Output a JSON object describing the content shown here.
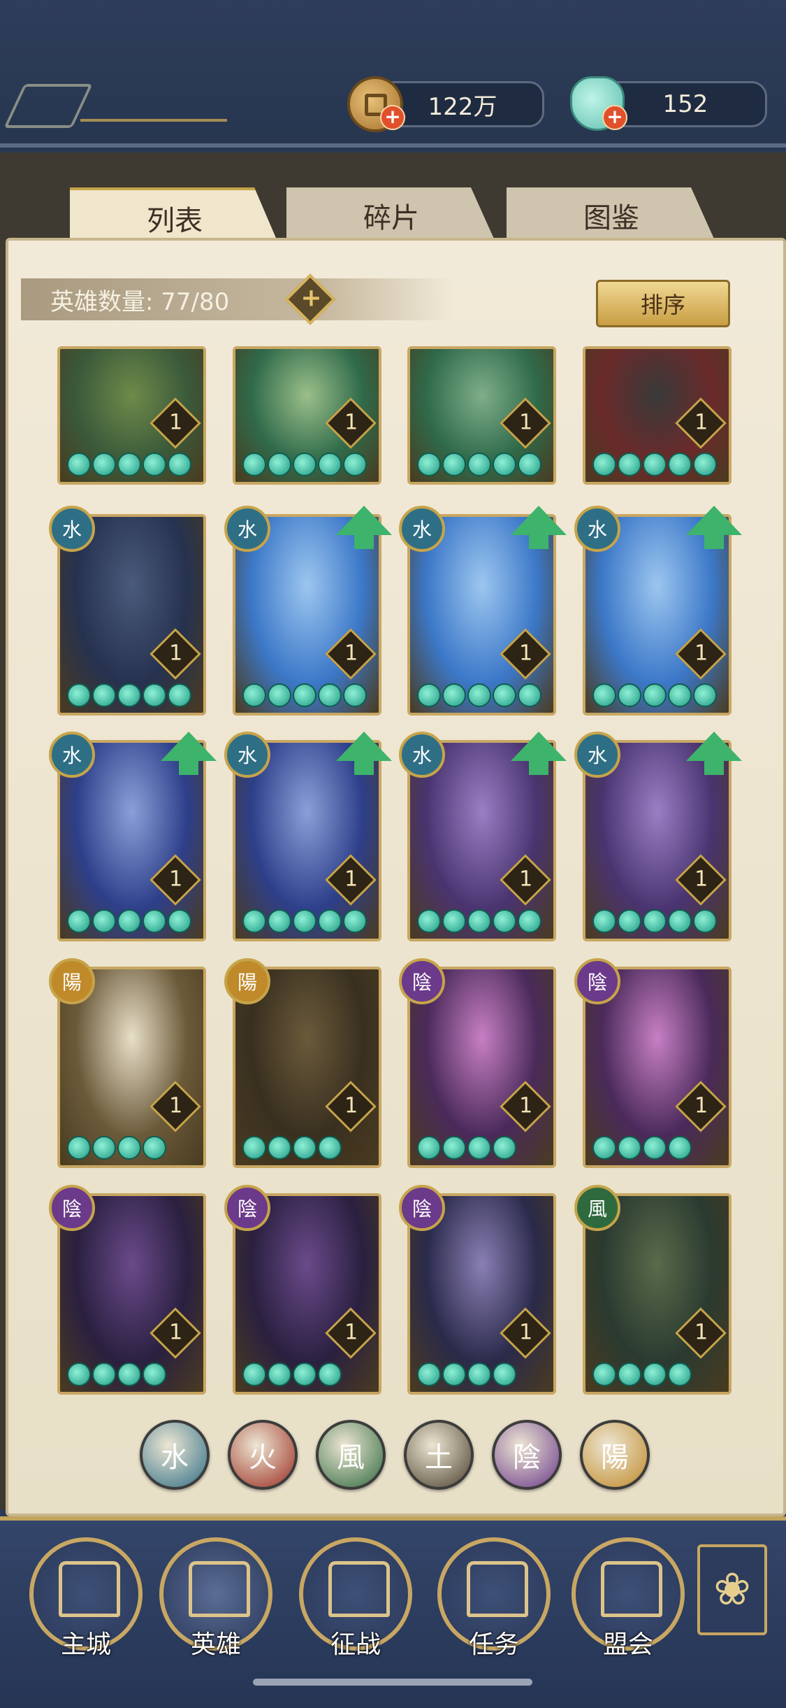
{
  "currencies": {
    "coins": {
      "value": "122万",
      "icon": "coin-icon"
    },
    "shells": {
      "value": "152",
      "icon": "jade-shell-icon"
    }
  },
  "tabs": [
    {
      "label": "列表",
      "active": true
    },
    {
      "label": "碎片",
      "active": false
    },
    {
      "label": "图鉴",
      "active": false
    }
  ],
  "hero_count": {
    "label": "英雄数量: 77/80"
  },
  "sort_button": {
    "label": "排序"
  },
  "heroes": [
    {
      "element": "",
      "level": "1",
      "stars": 5,
      "upgrade": false
    },
    {
      "element": "",
      "level": "1",
      "stars": 5,
      "upgrade": false
    },
    {
      "element": "",
      "level": "1",
      "stars": 5,
      "upgrade": false
    },
    {
      "element": "",
      "level": "1",
      "stars": 5,
      "upgrade": false
    },
    {
      "element": "水",
      "level": "1",
      "stars": 5,
      "upgrade": false
    },
    {
      "element": "水",
      "level": "1",
      "stars": 5,
      "upgrade": true
    },
    {
      "element": "水",
      "level": "1",
      "stars": 5,
      "upgrade": true
    },
    {
      "element": "水",
      "level": "1",
      "stars": 5,
      "upgrade": true
    },
    {
      "element": "水",
      "level": "1",
      "stars": 5,
      "upgrade": true
    },
    {
      "element": "水",
      "level": "1",
      "stars": 5,
      "upgrade": true
    },
    {
      "element": "水",
      "level": "1",
      "stars": 5,
      "upgrade": true
    },
    {
      "element": "水",
      "level": "1",
      "stars": 5,
      "upgrade": true
    },
    {
      "element": "陽",
      "level": "1",
      "stars": 4,
      "upgrade": false
    },
    {
      "element": "陽",
      "level": "1",
      "stars": 4,
      "upgrade": false
    },
    {
      "element": "陰",
      "level": "1",
      "stars": 4,
      "upgrade": false
    },
    {
      "element": "陰",
      "level": "1",
      "stars": 4,
      "upgrade": false
    },
    {
      "element": "陰",
      "level": "1",
      "stars": 4,
      "upgrade": false
    },
    {
      "element": "陰",
      "level": "1",
      "stars": 4,
      "upgrade": false
    },
    {
      "element": "陰",
      "level": "1",
      "stars": 4,
      "upgrade": false
    },
    {
      "element": "風",
      "level": "1",
      "stars": 4,
      "upgrade": false
    }
  ],
  "element_filters": [
    {
      "label": "水",
      "color": "#2f6f86"
    },
    {
      "label": "火",
      "color": "#9b2d21"
    },
    {
      "label": "風",
      "color": "#2f6a3e"
    },
    {
      "label": "土",
      "color": "#4d4130"
    },
    {
      "label": "陰",
      "color": "#6b3a8a"
    },
    {
      "label": "陽",
      "color": "#c08a2a"
    }
  ],
  "bottom_nav": [
    {
      "label": "主城",
      "icon": "city-gate-icon",
      "active": false
    },
    {
      "label": "英雄",
      "icon": "hero-portrait-icon",
      "active": true
    },
    {
      "label": "征战",
      "icon": "war-drum-icon",
      "active": false
    },
    {
      "label": "任务",
      "icon": "scroll-icon",
      "active": false
    },
    {
      "label": "盟会",
      "icon": "alliance-pavilion-icon",
      "active": false
    }
  ],
  "more_button": {
    "icon": "flower-menu-icon"
  }
}
